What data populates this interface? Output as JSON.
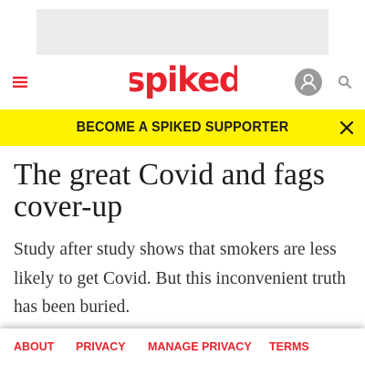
{
  "header": {
    "logo_text": "spiked",
    "menu_icon": "hamburger-menu-icon",
    "account_icon": "user-account-icon",
    "search_icon": "search-icon"
  },
  "promo": {
    "cta_label": "BECOME A SPIKED SUPPORTER",
    "close_icon": "close-icon"
  },
  "article": {
    "headline": "The great Covid and fags cover-up",
    "standfirst": "Study after study shows that smokers are less likely to get Covid. But this inconvenient truth has been buried."
  },
  "footer": {
    "links": [
      {
        "label": "ABOUT"
      },
      {
        "label": "PRIVACY"
      },
      {
        "label": "MANAGE PRIVACY"
      },
      {
        "label": "TERMS"
      }
    ]
  },
  "colors": {
    "brand_red": "#e8232d",
    "banner_yellow": "#fff200",
    "ad_placeholder": "#ececec",
    "icon_grey": "#9a9a9a",
    "text_dark": "#1c1c1c"
  }
}
